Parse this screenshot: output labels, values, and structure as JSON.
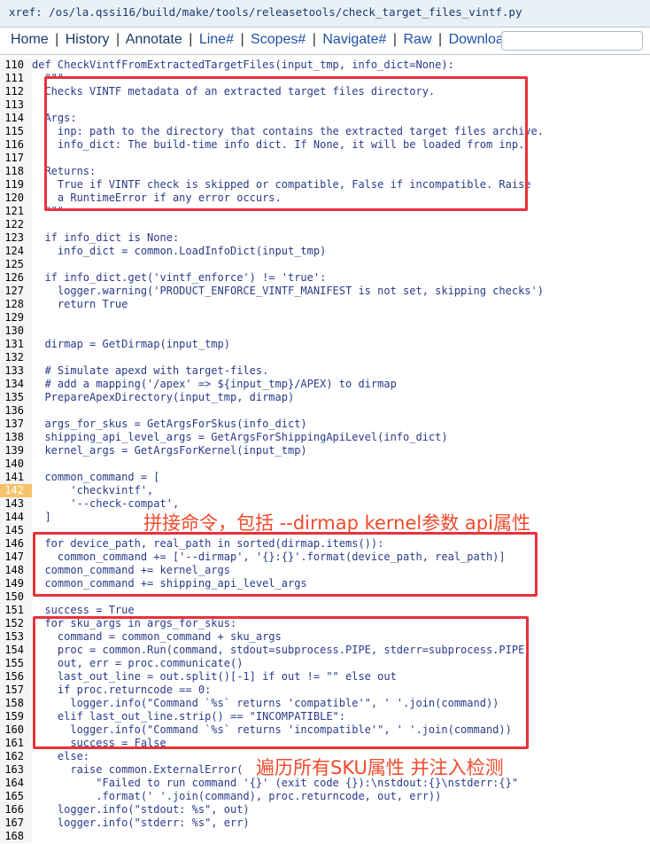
{
  "xref": "xref: /os/la.qssi16/build/make/tools/releasetools/check_target_files_vintf.py",
  "nav": [
    {
      "label": "Home"
    },
    {
      "label": "History"
    },
    {
      "label": "Annotate"
    },
    {
      "label": "Line#"
    },
    {
      "label": "Scopes#"
    },
    {
      "label": "Navigate#"
    },
    {
      "label": "Raw"
    },
    {
      "label": "Download"
    }
  ],
  "nav_separator": "|",
  "code": [
    {
      "n": "110",
      "t": "def CheckVintfFromExtractedTargetFiles(input_tmp, info_dict=None):"
    },
    {
      "n": "111",
      "t": "  \"\"\""
    },
    {
      "n": "112",
      "t": "  Checks VINTF metadata of an extracted target files directory."
    },
    {
      "n": "113",
      "t": ""
    },
    {
      "n": "114",
      "t": "  Args:"
    },
    {
      "n": "115",
      "t": "    inp: path to the directory that contains the extracted target files archive."
    },
    {
      "n": "116",
      "t": "    info_dict: The build-time info dict. If None, it will be loaded from inp."
    },
    {
      "n": "117",
      "t": ""
    },
    {
      "n": "118",
      "t": "  Returns:"
    },
    {
      "n": "119",
      "t": "    True if VINTF check is skipped or compatible, False if incompatible. Raise"
    },
    {
      "n": "120",
      "t": "    a RuntimeError if any error occurs."
    },
    {
      "n": "121",
      "t": "  \"\"\""
    },
    {
      "n": "122",
      "t": ""
    },
    {
      "n": "123",
      "t": "  if info_dict is None:"
    },
    {
      "n": "124",
      "t": "    info_dict = common.LoadInfoDict(input_tmp)"
    },
    {
      "n": "125",
      "t": ""
    },
    {
      "n": "126",
      "t": "  if info_dict.get('vintf_enforce') != 'true':"
    },
    {
      "n": "127",
      "t": "    logger.warning('PRODUCT_ENFORCE_VINTF_MANIFEST is not set, skipping checks')"
    },
    {
      "n": "128",
      "t": "    return True"
    },
    {
      "n": "129",
      "t": ""
    },
    {
      "n": "130",
      "t": ""
    },
    {
      "n": "131",
      "t": "  dirmap = GetDirmap(input_tmp)"
    },
    {
      "n": "132",
      "t": ""
    },
    {
      "n": "133",
      "t": "  # Simulate apexd with target-files."
    },
    {
      "n": "134",
      "t": "  # add a mapping('/apex' => ${input_tmp}/APEX) to dirmap"
    },
    {
      "n": "135",
      "t": "  PrepareApexDirectory(input_tmp, dirmap)"
    },
    {
      "n": "136",
      "t": ""
    },
    {
      "n": "137",
      "t": "  args_for_skus = GetArgsForSkus(info_dict)"
    },
    {
      "n": "138",
      "t": "  shipping_api_level_args = GetArgsForShippingApiLevel(info_dict)"
    },
    {
      "n": "139",
      "t": "  kernel_args = GetArgsForKernel(input_tmp)"
    },
    {
      "n": "140",
      "t": ""
    },
    {
      "n": "141",
      "t": "  common_command = ["
    },
    {
      "n": "142",
      "t": "      'checkvintf',"
    },
    {
      "n": "143",
      "t": "      '--check-compat',"
    },
    {
      "n": "144",
      "t": "  ]"
    },
    {
      "n": "145",
      "t": ""
    },
    {
      "n": "146",
      "t": "  for device_path, real_path in sorted(dirmap.items()):"
    },
    {
      "n": "147",
      "t": "    common_command += ['--dirmap', '{}:{}'.format(device_path, real_path)]"
    },
    {
      "n": "148",
      "t": "  common_command += kernel_args"
    },
    {
      "n": "149",
      "t": "  common_command += shipping_api_level_args"
    },
    {
      "n": "150",
      "t": ""
    },
    {
      "n": "151",
      "t": "  success = True"
    },
    {
      "n": "152",
      "t": "  for sku_args in args_for_skus:"
    },
    {
      "n": "153",
      "t": "    command = common_command + sku_args"
    },
    {
      "n": "154",
      "t": "    proc = common.Run(command, stdout=subprocess.PIPE, stderr=subprocess.PIPE)"
    },
    {
      "n": "155",
      "t": "    out, err = proc.communicate()"
    },
    {
      "n": "156",
      "t": "    last_out_line = out.split()[-1] if out != \"\" else out"
    },
    {
      "n": "157",
      "t": "    if proc.returncode == 0:"
    },
    {
      "n": "158",
      "t": "      logger.info(\"Command `%s` returns 'compatible'\", ' '.join(command))"
    },
    {
      "n": "159",
      "t": "    elif last_out_line.strip() == \"INCOMPATIBLE\":"
    },
    {
      "n": "160",
      "t": "      logger.info(\"Command `%s` returns 'incompatible'\", ' '.join(command))"
    },
    {
      "n": "161",
      "t": "      success = False"
    },
    {
      "n": "162",
      "t": "    else:"
    },
    {
      "n": "163",
      "t": "      raise common.ExternalError("
    },
    {
      "n": "164",
      "t": "          \"Failed to run command '{}' (exit code {}):\\nstdout:{}\\nstderr:{}\""
    },
    {
      "n": "165",
      "t": "          .format(' '.join(command), proc.returncode, out, err))"
    },
    {
      "n": "166",
      "t": "    logger.info(\"stdout: %s\", out)"
    },
    {
      "n": "167",
      "t": "    logger.info(\"stderr: %s\", err)"
    },
    {
      "n": "168",
      "t": ""
    }
  ],
  "highlighted_line": "142",
  "annotations": {
    "build_command": "拼接命令，包括 --dirmap kernel参数 api属性",
    "iterate_skus": "遍历所有SKU属性 并注入检测"
  },
  "colors": {
    "annotation": "#ef4a2b",
    "box": "#e8323a",
    "line_highlight": "#f5c46a",
    "code_text": "#2a3a8a"
  }
}
